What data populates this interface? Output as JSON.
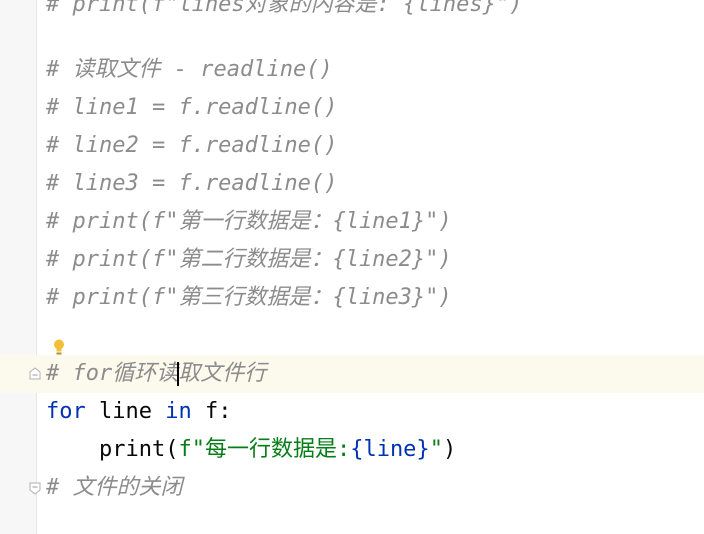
{
  "editor": {
    "lines": [
      {
        "id": "top-partial",
        "text": "# print(f\"lines对象的内容是: {lines}\")"
      },
      {
        "id": "blank-1",
        "text": ""
      },
      {
        "id": "c1",
        "text": "# 读取文件 - readline()"
      },
      {
        "id": "c2",
        "text": "# line1 = f.readline()"
      },
      {
        "id": "c3",
        "text": "# line2 = f.readline()"
      },
      {
        "id": "c4",
        "text": "# line3 = f.readline()"
      },
      {
        "id": "c5",
        "text": "# print(f\"第一行数据是：{line1}\")"
      },
      {
        "id": "c6",
        "text": "# print(f\"第二行数据是：{line2}\")"
      },
      {
        "id": "c7",
        "text": "# print(f\"第三行数据是：{line3}\")"
      },
      {
        "id": "blank-2",
        "text": ""
      },
      {
        "id": "for-comment-a",
        "text": "# for循环读"
      },
      {
        "id": "for-comment-b",
        "text": "取文件行"
      },
      {
        "id": "for-kw",
        "text": "for"
      },
      {
        "id": "for-var",
        "text": " line "
      },
      {
        "id": "in-kw",
        "text": "in"
      },
      {
        "id": "for-rest",
        "text": " f:"
      },
      {
        "id": "print-fn",
        "text": "    print("
      },
      {
        "id": "print-str-a",
        "text": "f\"每一行数据是:"
      },
      {
        "id": "print-brace-expr",
        "text": "{line}"
      },
      {
        "id": "print-str-b",
        "text": "\""
      },
      {
        "id": "print-close",
        "text": ")"
      },
      {
        "id": "close-comment",
        "text": "# 文件的关闭"
      }
    ]
  },
  "colors": {
    "comment": "#8c8c8c",
    "keyword": "#0033b3",
    "string": "#067d17",
    "current_line": "#fcfaed",
    "gutter": "#f7f7f7"
  },
  "icons": {
    "intention_bulb": "lightbulb-icon",
    "fold_marker": "fold-icon"
  }
}
